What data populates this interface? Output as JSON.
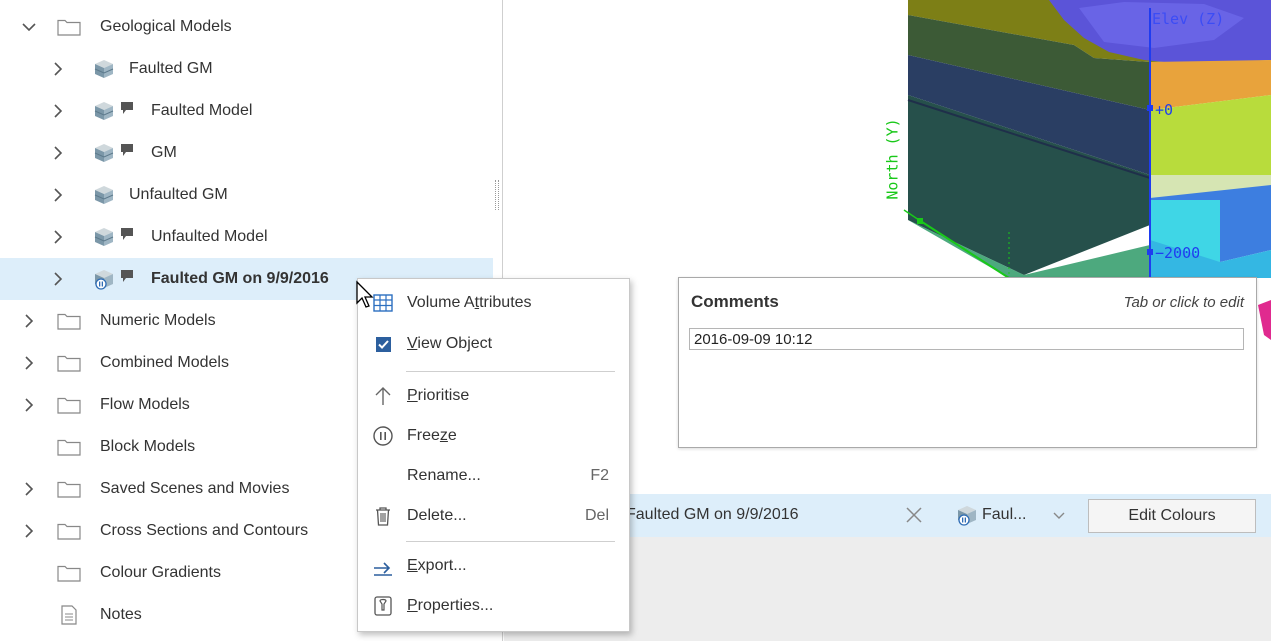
{
  "tree": {
    "items": [
      {
        "label": "Geological Models",
        "type": "folder",
        "expanded": true
      },
      {
        "label": "Faulted GM",
        "type": "model",
        "has_comment": false
      },
      {
        "label": "Faulted Model",
        "type": "model",
        "has_comment": true
      },
      {
        "label": "GM",
        "type": "model",
        "has_comment": true
      },
      {
        "label": "Unfaulted GM",
        "type": "model",
        "has_comment": false
      },
      {
        "label": "Unfaulted Model",
        "type": "model",
        "has_comment": true
      },
      {
        "label": "Faulted GM on 9/9/2016",
        "type": "model",
        "has_comment": true,
        "selected": true
      },
      {
        "label": "Numeric Models",
        "type": "folder"
      },
      {
        "label": "Combined Models",
        "type": "folder"
      },
      {
        "label": "Flow Models",
        "type": "folder"
      },
      {
        "label": "Block Models",
        "type": "folder"
      },
      {
        "label": "Saved Scenes and Movies",
        "type": "folder"
      },
      {
        "label": "Cross Sections and Contours",
        "type": "folder"
      },
      {
        "label": "Colour Gradients",
        "type": "folder"
      },
      {
        "label": "Notes",
        "type": "notes"
      }
    ]
  },
  "scene": {
    "axis_elev": "Elev (Z)",
    "axis_north": "North (Y)",
    "tick_zero": "+0",
    "tick_2000": "−2000"
  },
  "comments": {
    "title": "Comments",
    "hint": "Tab or click to edit",
    "value": "2016-09-09 10:12"
  },
  "bottom_bar": {
    "object_name": "Faulted GM on 9/9/2016",
    "model_dropdown": "Faul...",
    "edit_colours": "Edit Colours"
  },
  "context_menu": {
    "items": [
      {
        "label_pre": "Volume A",
        "label_u": "t",
        "label_post": "tributes",
        "icon": "grid-icon"
      },
      {
        "label_pre": "",
        "label_u": "V",
        "label_post": "iew Object",
        "icon": "checkbox-checked-icon"
      },
      {
        "label_pre": "",
        "label_u": "P",
        "label_post": "rioritise",
        "icon": "arrow-up-icon"
      },
      {
        "label_pre": "Free",
        "label_u": "z",
        "label_post": "e",
        "icon": "pause-circle-icon"
      },
      {
        "label_pre": "Rename...",
        "label_u": "",
        "label_post": "",
        "shortcut": "F2"
      },
      {
        "label_pre": "Delete...",
        "label_u": "",
        "label_post": "",
        "shortcut": "Del",
        "icon": "trash-icon"
      },
      {
        "label_pre": "",
        "label_u": "E",
        "label_post": "xport...",
        "icon": "export-arrow-icon"
      },
      {
        "label_pre": "",
        "label_u": "P",
        "label_post": "roperties...",
        "icon": "properties-icon"
      }
    ]
  },
  "colors": {
    "selection": "#ddeefa",
    "axis_blue": "#1f3cf0",
    "axis_green": "#19c819",
    "check_blue": "#2c5f9e"
  }
}
